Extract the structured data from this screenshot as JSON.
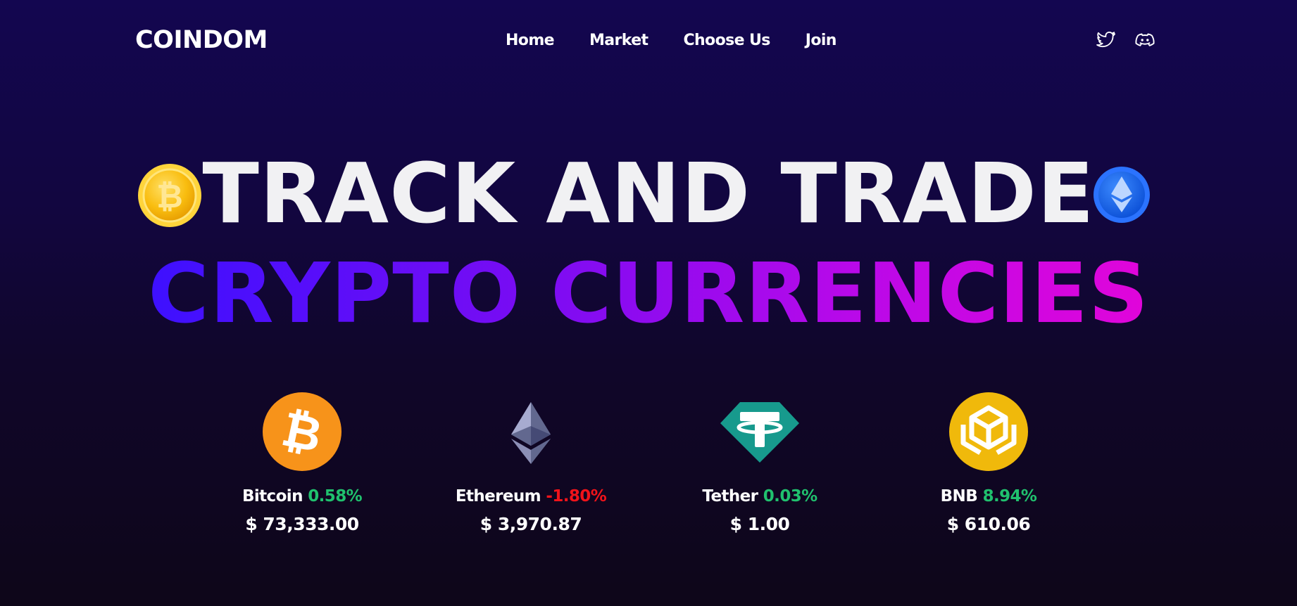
{
  "nav": {
    "logo": "COINDOM",
    "links": [
      "Home",
      "Market",
      "Choose Us",
      "Join"
    ],
    "socials": [
      "twitter-icon",
      "discord-icon"
    ]
  },
  "hero": {
    "line1": "TRACK AND TRADE",
    "line2": "CRYPTO CURRENCIES",
    "left_coin": "bitcoin-coin-icon",
    "right_coin": "ethereum-coin-icon"
  },
  "coins": [
    {
      "name": "Bitcoin",
      "change": "0.58%",
      "price": "$ 73,333.00",
      "icon": "bitcoin-icon",
      "direction": "up"
    },
    {
      "name": "Ethereum",
      "change": "-1.80%",
      "price": "$ 3,970.87",
      "icon": "ethereum-icon",
      "direction": "down"
    },
    {
      "name": "Tether",
      "change": "0.03%",
      "price": "$ 1.00",
      "icon": "tether-icon",
      "direction": "up"
    },
    {
      "name": "BNB",
      "change": "8.94%",
      "price": "$ 610.06",
      "icon": "bnb-icon",
      "direction": "up"
    }
  ],
  "colors": {
    "background_top": "#130650",
    "background_bottom": "#0e0619",
    "gradient_start": "#3d10ff",
    "gradient_end": "#e105da",
    "positive": "#20c16e",
    "negative": "#f0131a"
  }
}
